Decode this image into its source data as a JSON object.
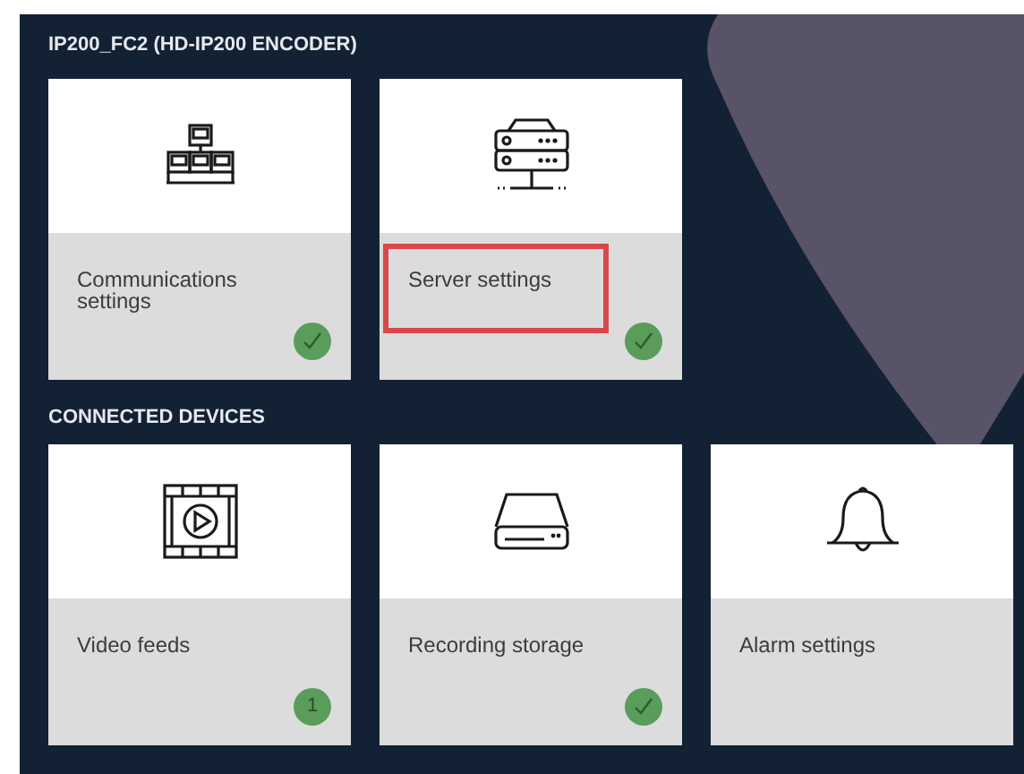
{
  "sections": [
    {
      "label": "IP200_FC2 (HD-IP200 ENCODER)",
      "cards": [
        {
          "kind": "network",
          "label": "Communications settings",
          "highlighted": false,
          "badge": {
            "kind": "check"
          }
        },
        {
          "kind": "server",
          "label": "Server settings",
          "highlighted": true,
          "badge": {
            "kind": "check"
          }
        }
      ]
    },
    {
      "label": "CONNECTED DEVICES",
      "cards": [
        {
          "kind": "video",
          "label": "Video feeds",
          "highlighted": false,
          "badge": {
            "kind": "count",
            "text": "1"
          }
        },
        {
          "kind": "storage",
          "label": "Recording storage",
          "highlighted": false,
          "badge": {
            "kind": "check"
          }
        },
        {
          "kind": "alarm",
          "label": "Alarm settings",
          "highlighted": false
        }
      ]
    }
  ]
}
